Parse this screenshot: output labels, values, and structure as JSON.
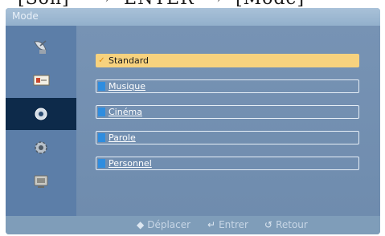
{
  "caption": {
    "text": "  [Son]    →  ENTER  →  [Mode]"
  },
  "window": {
    "title": "Mode"
  },
  "sidebar": {
    "items": [
      {
        "icon": "satellite-dish-icon",
        "active": false
      },
      {
        "icon": "picture-icon",
        "active": false
      },
      {
        "icon": "sound-icon",
        "active": true
      },
      {
        "icon": "setup-gear-icon",
        "active": false
      },
      {
        "icon": "input-monitor-icon",
        "active": false
      }
    ]
  },
  "menu": {
    "items": [
      {
        "label": "Standard",
        "selected": true
      },
      {
        "label": "Musique",
        "selected": false
      },
      {
        "label": "Cinéma",
        "selected": false
      },
      {
        "label": "Parole",
        "selected": false
      },
      {
        "label": "Personnel",
        "selected": false
      }
    ],
    "check_glyph": "✓"
  },
  "footer": {
    "move": {
      "glyph": "◆",
      "label": "Déplacer"
    },
    "enter": {
      "glyph": "↵",
      "label": "Entrer"
    },
    "back": {
      "glyph": "↺",
      "label": "Retour"
    }
  },
  "colors": {
    "window_bg": "#7f9db9",
    "sidebar_bg": "#5c7ea8",
    "sidebar_active": "#0d2a4a",
    "selection": "#f7d27e",
    "marker": "#2f8ddf"
  }
}
